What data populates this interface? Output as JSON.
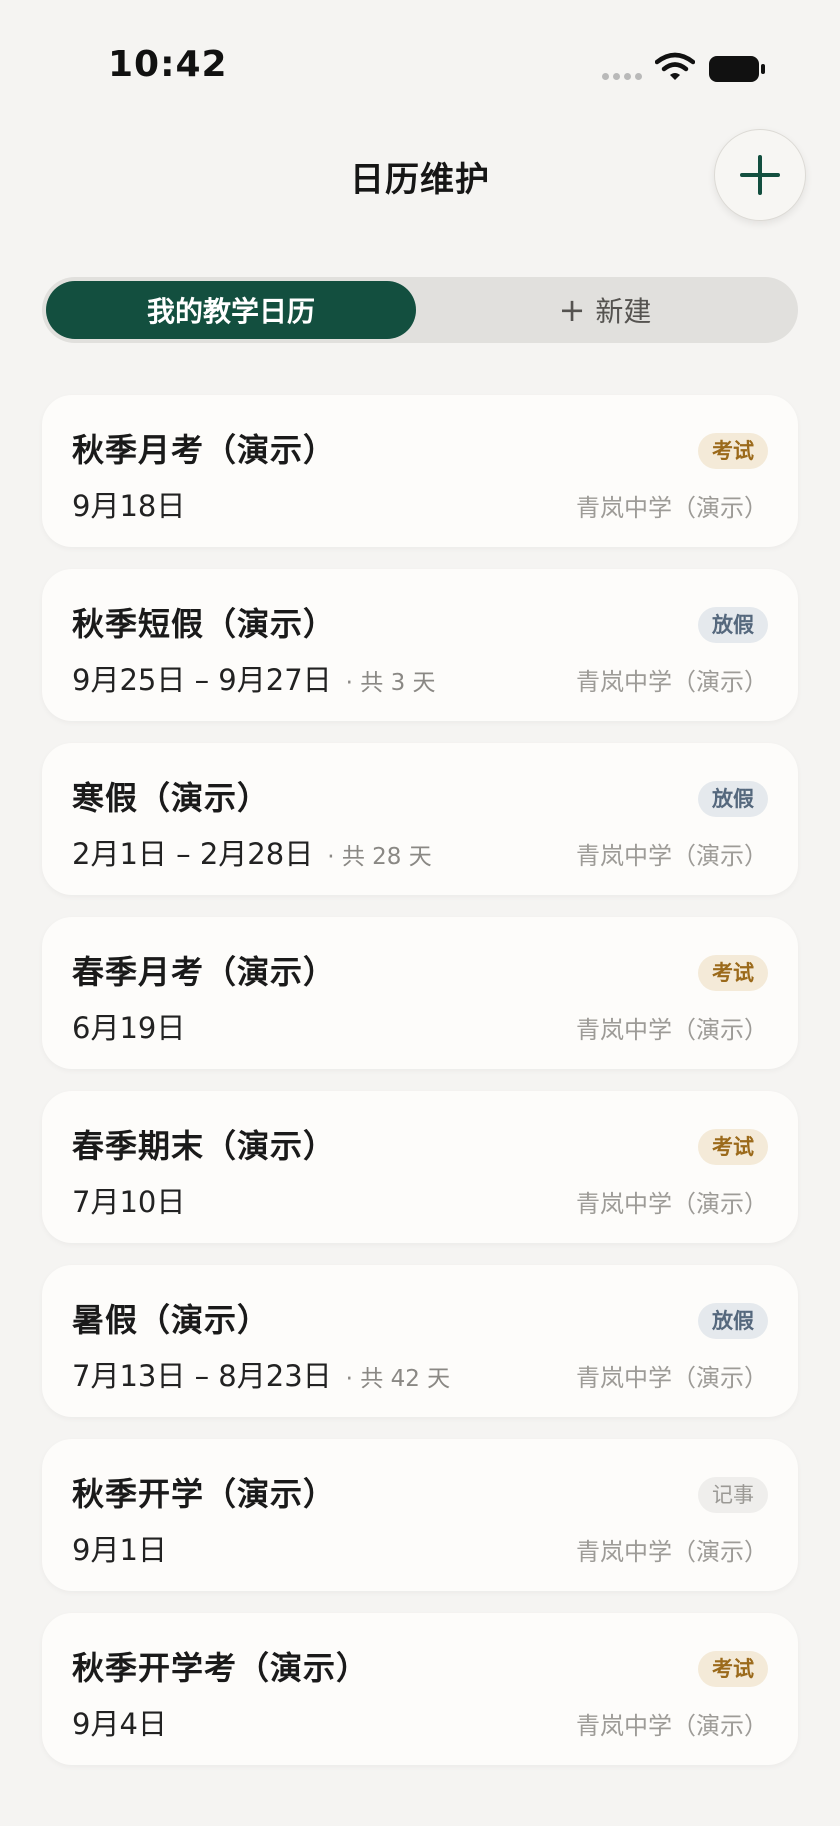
{
  "status_bar": {
    "time": "10:42"
  },
  "nav": {
    "title": "日历维护",
    "add_icon": "plus-icon"
  },
  "segment": {
    "tabs": [
      {
        "label": "我的教学日历",
        "active": true
      },
      {
        "label": "新建",
        "prefix": "+",
        "active": false
      }
    ]
  },
  "events": [
    {
      "title": "秋季月考（演示）",
      "date": "9月18日",
      "days": "",
      "badge": "考试",
      "badge_type": "exam",
      "school": "青岚中学（演示）"
    },
    {
      "title": "秋季短假（演示）",
      "date": "9月25日 – 9月27日",
      "days": "· 共 3 天",
      "badge": "放假",
      "badge_type": "holiday",
      "school": "青岚中学（演示）"
    },
    {
      "title": "寒假（演示）",
      "date": "2月1日 – 2月28日",
      "days": "· 共 28 天",
      "badge": "放假",
      "badge_type": "holiday",
      "school": "青岚中学（演示）"
    },
    {
      "title": "春季月考（演示）",
      "date": "6月19日",
      "days": "",
      "badge": "考试",
      "badge_type": "exam",
      "school": "青岚中学（演示）"
    },
    {
      "title": "春季期末（演示）",
      "date": "7月10日",
      "days": "",
      "badge": "考试",
      "badge_type": "exam",
      "school": "青岚中学（演示）"
    },
    {
      "title": "暑假（演示）",
      "date": "7月13日 – 8月23日",
      "days": "· 共 42 天",
      "badge": "放假",
      "badge_type": "holiday",
      "school": "青岚中学（演示）"
    },
    {
      "title": "秋季开学（演示）",
      "date": "9月1日",
      "days": "",
      "badge": "记事",
      "badge_type": "note",
      "school": "青岚中学（演示）"
    },
    {
      "title": "秋季开学考（演示）",
      "date": "9月4日",
      "days": "",
      "badge": "考试",
      "badge_type": "exam",
      "school": "青岚中学（演示）"
    }
  ],
  "colors": {
    "accent": "#134f3f",
    "background": "#f5f4f2",
    "exam_badge": "#f4ead8",
    "holiday_badge": "#e5e9ed",
    "note_badge": "#efeeec"
  }
}
